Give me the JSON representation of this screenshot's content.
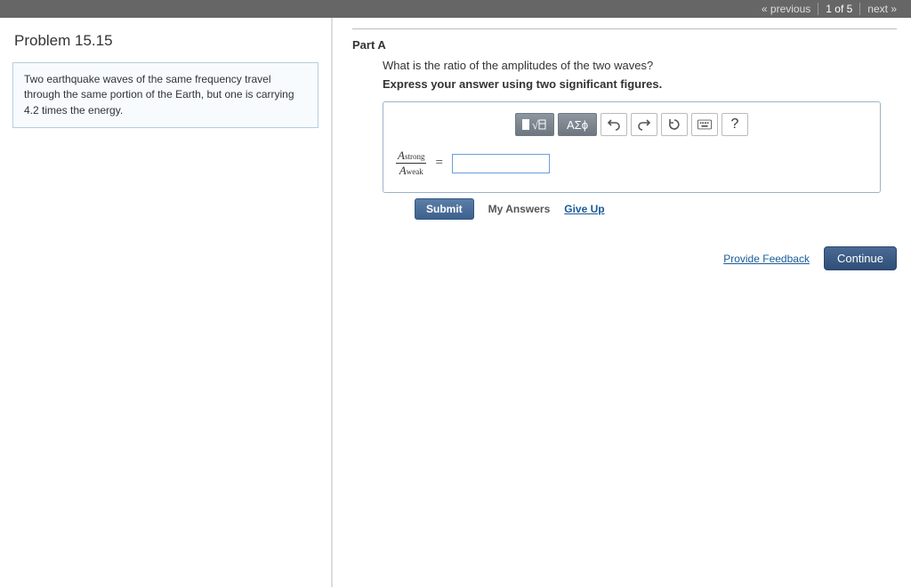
{
  "nav": {
    "prev": "« previous",
    "position": "1 of 5",
    "next": "next »"
  },
  "left": {
    "title": "Problem 15.15",
    "statement": "Two earthquake waves of the same frequency travel through the same portion of the Earth, but one is carrying 4.2 times the energy."
  },
  "partA": {
    "label": "Part A",
    "question": "What is the ratio of the amplitudes of the two waves?",
    "instruction": "Express your answer using two significant figures.",
    "toolbar": {
      "templates": "▮√",
      "greek": "ΑΣϕ",
      "help": "?"
    },
    "equation": {
      "num_sym": "A",
      "num_sub": "strong",
      "den_sym": "A",
      "den_sub": "weak",
      "equals": "="
    },
    "answer_value": "",
    "submit": "Submit",
    "my_answers": "My Answers",
    "give_up": "Give Up"
  },
  "footer": {
    "feedback": "Provide Feedback",
    "continue": "Continue"
  }
}
